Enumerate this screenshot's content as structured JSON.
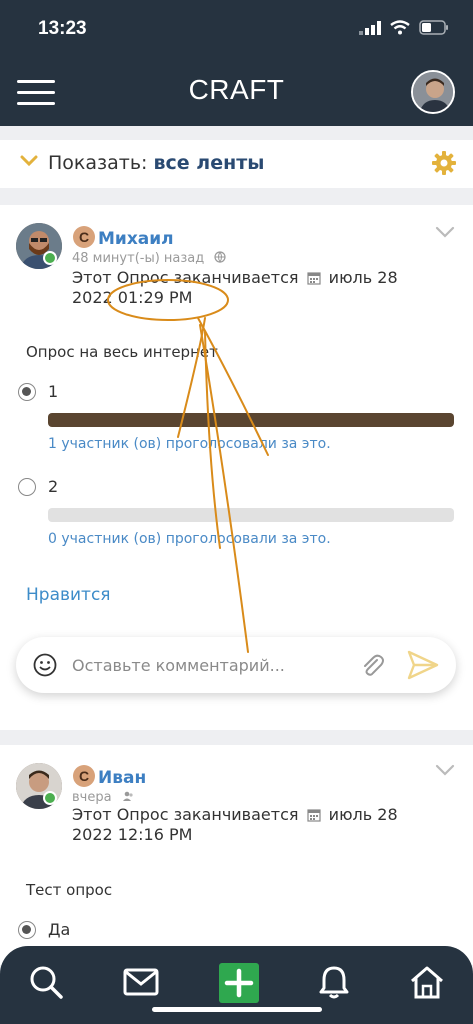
{
  "status_bar": {
    "time": "13:23"
  },
  "app_bar": {
    "title": "CRAFT",
    "menu_icon": "hamburger-menu-icon"
  },
  "filter": {
    "prefix": "Показать:",
    "value": "все ленты"
  },
  "posts": [
    {
      "author": "Михаил",
      "badge": "С",
      "time": "48 минут(-ы) назад",
      "poll_end_prefix": "Этот Опрос заканчивается",
      "poll_end_date": "июль 28",
      "poll_end_time": "2022 01:29 PM",
      "question": "Опрос на весь интернет",
      "options": [
        {
          "label": "1",
          "selected": true,
          "share": 1.0,
          "votes_text": "1 участник (ов) проголосовали за это."
        },
        {
          "label": "2",
          "selected": false,
          "share": 0.0,
          "votes_text": "0 участник (ов) проголосовали за это."
        }
      ],
      "like_label": "Нравится"
    },
    {
      "author": "Иван",
      "badge": "С",
      "time": "вчера",
      "poll_end_prefix": "Этот Опрос заканчивается",
      "poll_end_date": "июль 28",
      "poll_end_time": "2022 12:16 PM",
      "question": "Тест опрос",
      "options": [
        {
          "label": "Да",
          "selected": true
        }
      ]
    }
  ],
  "comment": {
    "placeholder": "Оставьте комментарий..."
  },
  "colors": {
    "header": "#263340",
    "link": "#3d7fc2",
    "accent": "#e3b23c",
    "bar_fill": "#5a4530",
    "add_button": "#2fa84f",
    "annotation": "#d98b1a"
  }
}
